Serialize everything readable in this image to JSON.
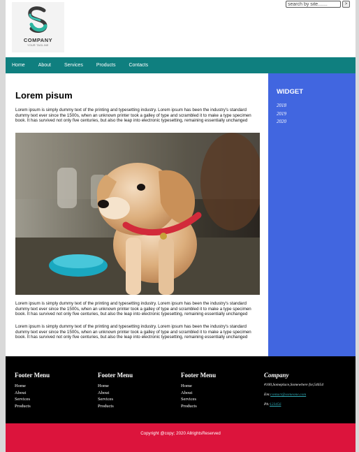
{
  "header": {
    "logo_name": "COMPANY",
    "logo_tagline": "YOUR TAGLINE",
    "search_placeholder": "search by site.......",
    "search_button": ">"
  },
  "nav": [
    "Home",
    "About",
    "Services",
    "Products",
    "Contacts"
  ],
  "main": {
    "title": "Lorem pisum",
    "paragraphs": [
      "Lorem ipsum is simply dummy text of the printing and typesetting industry. Lorem ipsum has been the industry's standard dummy text ever since the 1500s, when an unknown printer took a galley of type and scrambled it to make a type specimen book. It has survived not only five centuries, but also the leap into electronic typesetting, remaining essentially unchanged",
      "Lorem ipsum is simply dummy text of the printing and typesetting industry. Lorem ipsum has been the industry's standard dummy text ever since the 1500s, when an unknown printer took a galley of type and scrambled it to make a type specimen book. It has survived not only five centuries, but also the leap into electronic typesetting, remaining essentially unchanged",
      "Lorem ipsum is simply dummy text of the printing and typesetting industry. Lorem ipsum has been the industry's standard dummy text ever since the 1500s, when an unknown printer took a galley of type and scrambled it to make a type specimen book. It has survived not only five centuries, but also the leap into electronic typesetting, remaining essentially unchanged"
    ]
  },
  "sidebar": {
    "title": "WIDGET",
    "items": [
      "2018",
      "2019",
      "2020"
    ]
  },
  "footer": {
    "columns": [
      {
        "title": "Footer Menu",
        "items": [
          "Home",
          "About",
          "Services",
          "Products"
        ]
      },
      {
        "title": "Footer Menu",
        "items": [
          "Home",
          "About",
          "Services",
          "Products"
        ]
      },
      {
        "title": "Footer Menu",
        "items": [
          "Home",
          "About",
          "Services",
          "Products"
        ]
      }
    ],
    "company": {
      "title": "Company",
      "address": "#100,Someplace,Somewhere for,54654",
      "email_label": "Em:",
      "email": "contact@someone.com",
      "phone_label": "Ph:",
      "phone": "123456"
    },
    "copyright": "Copyright @copy; 2020 AllrightsReserved"
  },
  "colors": {
    "nav_bg": "#0f7f7f",
    "sidebar_bg": "#4166e0",
    "footer_bg": "#000000",
    "copyright_bg": "#dc143c",
    "page_bg": "#d9d9d9"
  }
}
